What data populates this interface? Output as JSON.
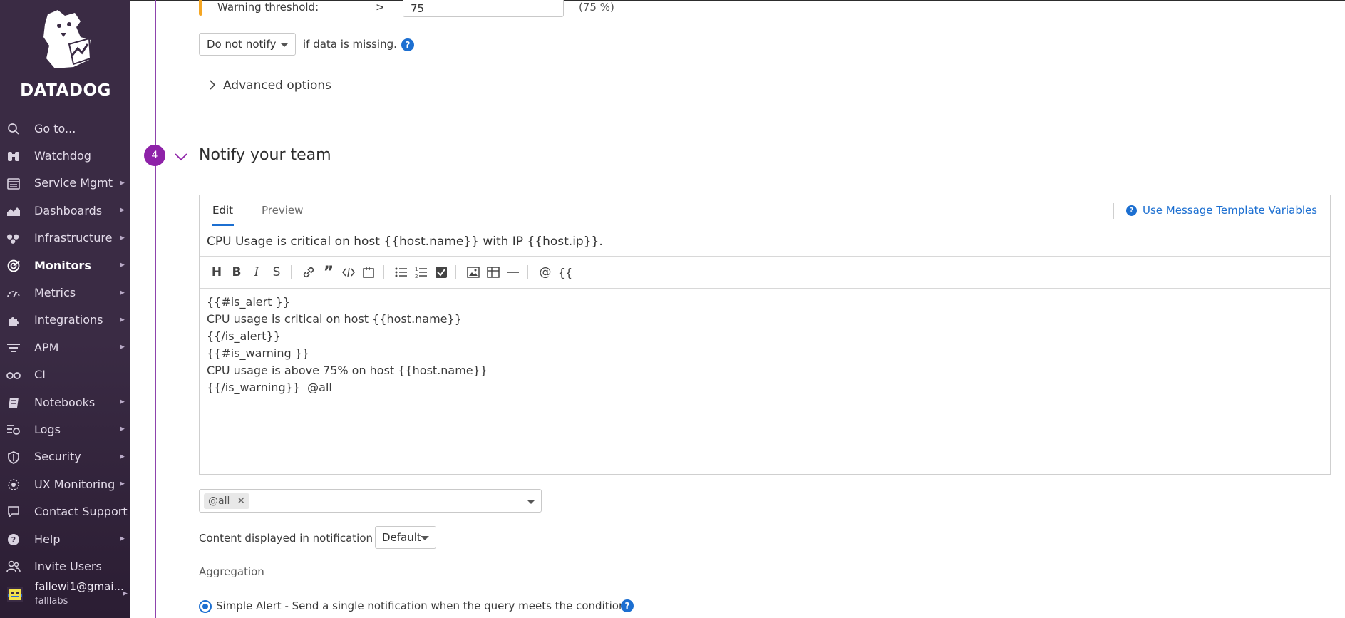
{
  "brand": {
    "name": "DATADOG"
  },
  "sidebar": {
    "items": [
      {
        "label": "Go to...",
        "icon": "search-icon",
        "arrow": false
      },
      {
        "label": "Watchdog",
        "icon": "binoculars-icon",
        "arrow": false
      },
      {
        "label": "Service Mgmt",
        "icon": "service-mgmt-icon",
        "arrow": true
      },
      {
        "label": "Dashboards",
        "icon": "dashboard-chart-icon",
        "arrow": true
      },
      {
        "label": "Infrastructure",
        "icon": "infrastructure-icon",
        "arrow": true
      },
      {
        "label": "Monitors",
        "icon": "monitors-icon",
        "arrow": true,
        "active": true
      },
      {
        "label": "Metrics",
        "icon": "metrics-gauge-icon",
        "arrow": true
      },
      {
        "label": "Integrations",
        "icon": "puzzle-icon",
        "arrow": true
      },
      {
        "label": "APM",
        "icon": "apm-icon",
        "arrow": true
      },
      {
        "label": "CI",
        "icon": "ci-icon",
        "arrow": false
      },
      {
        "label": "Notebooks",
        "icon": "notebook-icon",
        "arrow": true
      },
      {
        "label": "Logs",
        "icon": "logs-icon",
        "arrow": true
      },
      {
        "label": "Security",
        "icon": "shield-icon",
        "arrow": true
      },
      {
        "label": "UX Monitoring",
        "icon": "ux-monitoring-icon",
        "arrow": true
      },
      {
        "label": "Contact Support",
        "icon": "chat-icon",
        "arrow": false
      },
      {
        "label": "Help",
        "icon": "help-icon",
        "arrow": true
      },
      {
        "label": "Invite Users",
        "icon": "users-icon",
        "arrow": false
      }
    ],
    "user": {
      "email": "fallewi1@gmai...",
      "org": "falllabs"
    }
  },
  "threshold": {
    "warning_label": "Warning threshold:",
    "operator": ">",
    "warning_value": "75",
    "warning_percent": "(75 %)"
  },
  "missing_data": {
    "select_value": "Do not notify",
    "suffix": "if data is missing."
  },
  "advanced": {
    "label": "Advanced options"
  },
  "notify": {
    "step_number": "4",
    "title": "Notify your team",
    "tabs": {
      "edit": "Edit",
      "preview": "Preview"
    },
    "template_link": "Use Message Template Variables",
    "message_title": "CPU Usage is critical on host {{host.name}} with IP {{host.ip}}.",
    "message_body": "{{#is_alert }}\nCPU usage is critical on host {{host.name}}\n{{/is_alert}}\n{{#is_warning }}\nCPU usage is above 75% on host {{host.name}}\n{{/is_warning}}  @all",
    "recipient_chip": "@all",
    "content_label": "Content displayed in notification",
    "content_value": "Default",
    "aggregation_label": "Aggregation",
    "simple_alert_label": "Simple Alert - Send a single notification when the query meets the condition."
  },
  "toolbar": {
    "heading": "H",
    "bold": "B",
    "italic": "I",
    "strike": "S",
    "mention": "@",
    "variable": "{{"
  },
  "colors": {
    "sidebar_bg": "#3a2b44",
    "accent_purple": "#8e22a8",
    "link_blue": "#1c6fd1",
    "warning_orange": "#f5a623"
  }
}
